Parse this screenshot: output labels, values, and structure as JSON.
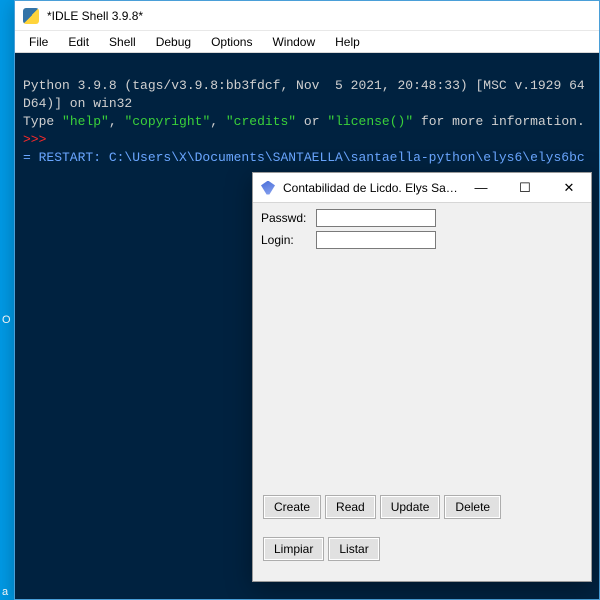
{
  "desktop": {
    "hint1": "O",
    "hint2": "a"
  },
  "idle": {
    "title": "*IDLE Shell 3.9.8*",
    "menu": [
      "File",
      "Edit",
      "Shell",
      "Debug",
      "Options",
      "Window",
      "Help"
    ],
    "line1a": "Python 3.9.8 (tags/v3.9.8:bb3fdcf, Nov  5 2021, 20:48:33) [MSC v.1929 64",
    "line1b": "D64)] on win32",
    "line2a": "Type ",
    "line2b": "\"help\"",
    "line2c": ", ",
    "line2d": "\"copyright\"",
    "line2e": ", ",
    "line2f": "\"credits\"",
    "line2g": " or ",
    "line2h": "\"license()\"",
    "line2i": " for more information.",
    "prompt": ">>> ",
    "restart": "= RESTART: C:\\Users\\X\\Documents\\SANTAELLA\\santaella-python\\elys6\\elys6bc"
  },
  "tk": {
    "title": "Contabilidad de Licdo. Elys Sant...",
    "passwd_label": "Passwd:",
    "login_label": "Login:",
    "passwd_value": "",
    "login_value": "",
    "buttons": {
      "create": "Create",
      "read": "Read",
      "update": "Update",
      "delete": "Delete",
      "limpiar": "Limpiar",
      "listar": "Listar"
    },
    "win": {
      "min": "—",
      "max": "☐",
      "close": "✕"
    }
  }
}
